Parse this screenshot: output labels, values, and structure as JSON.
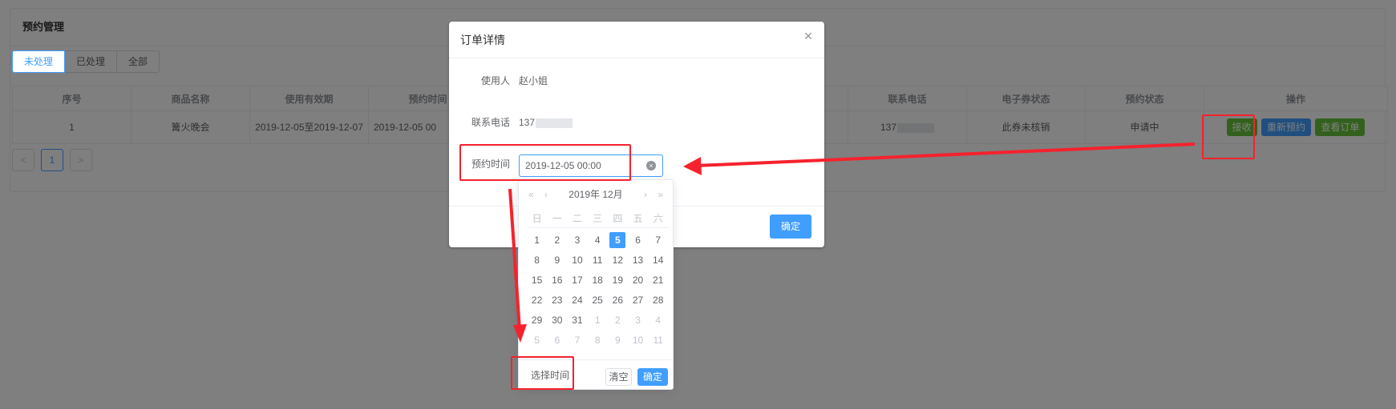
{
  "background": {
    "card_title": "预约管理",
    "tabs": [
      "未处理",
      "已处理",
      "全部"
    ],
    "table": {
      "headers": [
        "序号",
        "商品名称",
        "使用有效期",
        "预约时间",
        "",
        "",
        "",
        "联系电话",
        "电子券状态",
        "预约状态",
        "操作"
      ],
      "row": {
        "index": "1",
        "product": "篝火晚会",
        "validity": "2019-12-05至2019-12-07",
        "reserve_time": "2019-12-05 00",
        "phone": "137",
        "coupon_status": "此券未核销",
        "reserve_status": "申请中"
      },
      "actions": [
        "接收",
        "重新预约",
        "查看订单"
      ]
    },
    "pager": {
      "prev": "<",
      "page": "1",
      "next": ">"
    }
  },
  "dialog": {
    "title": "订单详情",
    "close_icon": "close-icon",
    "user_label": "使用人",
    "user_value": "赵小姐",
    "phone_label": "联系电话",
    "phone_value": "137",
    "time_label": "预约时间",
    "time_value": "2019-12-05 00:00",
    "confirm": "确定"
  },
  "date_picker": {
    "header": "2019年 12月",
    "nav": {
      "prev_year": "«",
      "prev_month": "‹",
      "next_month": "›",
      "next_year": "»"
    },
    "weekdays": [
      "日",
      "一",
      "二",
      "三",
      "四",
      "五",
      "六"
    ],
    "selected_day": "5",
    "days": [
      [
        "1",
        "2",
        "3",
        "4",
        "5",
        "6",
        "7"
      ],
      [
        "8",
        "9",
        "10",
        "11",
        "12",
        "13",
        "14"
      ],
      [
        "15",
        "16",
        "17",
        "18",
        "19",
        "20",
        "21"
      ],
      [
        "22",
        "23",
        "24",
        "25",
        "26",
        "27",
        "28"
      ],
      [
        "29",
        "30",
        "31",
        "1",
        "2",
        "3",
        "4"
      ],
      [
        "5",
        "6",
        "7",
        "8",
        "9",
        "10",
        "11"
      ]
    ],
    "pick_time": "选择时间",
    "clear": "清空",
    "ok": "确定"
  },
  "colors": {
    "primary": "#409eff",
    "success": "#67c23a",
    "annotation": "#f5222d"
  }
}
